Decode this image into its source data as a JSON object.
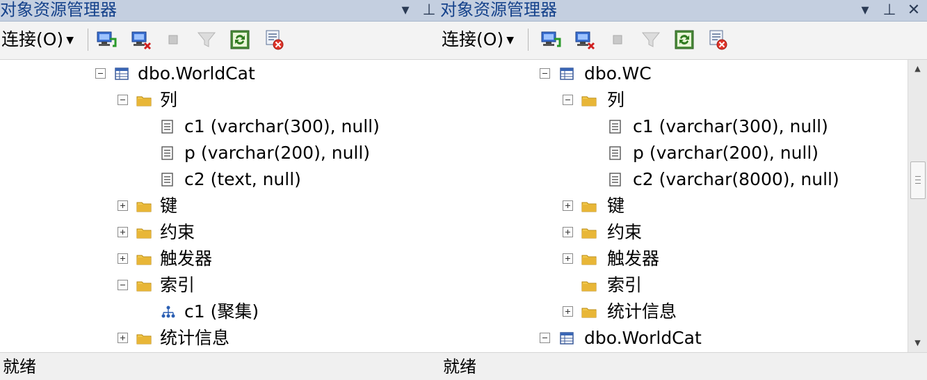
{
  "left": {
    "title": "对象资源管理器",
    "pin": "▾ ┴",
    "connect": "连接(O)",
    "tree": {
      "table": "dbo.WorldCat",
      "columns_folder": "列",
      "col1": "c1 (varchar(300), null)",
      "col2": "p (varchar(200), null)",
      "col3": "c2 (text, null)",
      "keys": "键",
      "constraints": "约束",
      "triggers": "触发器",
      "indexes": "索引",
      "index1": "c1 (聚集)",
      "statistics": "统计信息"
    },
    "status": "就绪"
  },
  "right": {
    "title": "对象资源管理器",
    "connect": "连接(O)",
    "tree": {
      "table": "dbo.WC",
      "columns_folder": "列",
      "col1": "c1 (varchar(300), null)",
      "col2": "p (varchar(200), null)",
      "col3": "c2 (varchar(8000), null)",
      "keys": "键",
      "constraints": "约束",
      "triggers": "触发器",
      "indexes": "索引",
      "statistics": "统计信息",
      "table2": "dbo.WorldCat"
    },
    "status": "就绪"
  },
  "icons": {
    "connect": "connect-object-explorer-icon",
    "disconnect": "disconnect-icon",
    "stop": "stop-icon",
    "filter": "filter-icon",
    "refresh": "refresh-icon",
    "summary": "stop-summary-icon",
    "table": "table-icon",
    "folder": "folder-icon",
    "column": "column-icon",
    "index": "index-icon"
  },
  "colors": {
    "titlebar": "#c4cfe0",
    "title_text": "#15428b",
    "folder": "#e8b637"
  }
}
